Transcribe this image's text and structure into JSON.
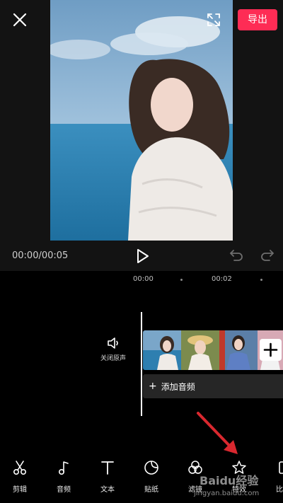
{
  "header": {
    "export_label": "导出",
    "icons": [
      "close-icon",
      "fullscreen-icon"
    ]
  },
  "player": {
    "time": "00:00/00:05",
    "icons": [
      "play-icon",
      "undo-icon",
      "redo-icon"
    ]
  },
  "timeline": {
    "ruler": [
      "00:00",
      "00:02"
    ],
    "mute_label": "关闭原声",
    "add_audio_label": "添加音频",
    "add_clip_symbol": "+"
  },
  "toolbar": {
    "items": [
      {
        "label": "剪辑",
        "icon": "scissors-icon"
      },
      {
        "label": "音频",
        "icon": "music-note-icon"
      },
      {
        "label": "文本",
        "icon": "text-icon"
      },
      {
        "label": "贴纸",
        "icon": "sticker-icon"
      },
      {
        "label": "滤镜",
        "icon": "filter-icon"
      },
      {
        "label": "特效",
        "icon": "effects-star-icon"
      },
      {
        "label": "比",
        "icon": "ratio-icon"
      }
    ]
  },
  "watermark": {
    "brand": "Baidu经验",
    "url": "jingyan.baidu.com"
  },
  "colors": {
    "export": "#fe2c55",
    "annotation_arrow": "#d9282f",
    "background": "#000000",
    "panel": "#262626"
  }
}
